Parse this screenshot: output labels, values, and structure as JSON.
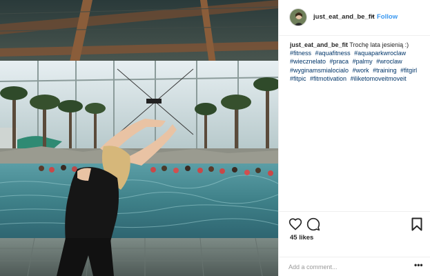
{
  "post": {
    "username": "just_eat_and_be_fit",
    "dot": "•",
    "follow_label": "Follow",
    "caption": {
      "username": "just_eat_and_be_fit",
      "text": "Trochę lata jesienią :)",
      "hashtags": [
        "#fitness",
        "#aquafitness",
        "#aquaparkwroclaw",
        "#wiecznelato",
        "#praca",
        "#palmy",
        "#wroclaw",
        "#wyginamsmialocialo",
        "#work",
        "#training",
        "#fitgirl",
        "#fitpic",
        "#fitmotivation",
        "#iliketomoveitmoveit"
      ]
    },
    "likes": "45 likes",
    "comment_placeholder": "Add a comment...",
    "more_label": "•••"
  },
  "icons": {
    "heart": "heart-icon",
    "comment": "comment-icon",
    "save": "bookmark-icon"
  },
  "colors": {
    "link_blue": "#3897f0",
    "hashtag_blue": "#003569",
    "text": "#262626",
    "border": "#efefef"
  }
}
